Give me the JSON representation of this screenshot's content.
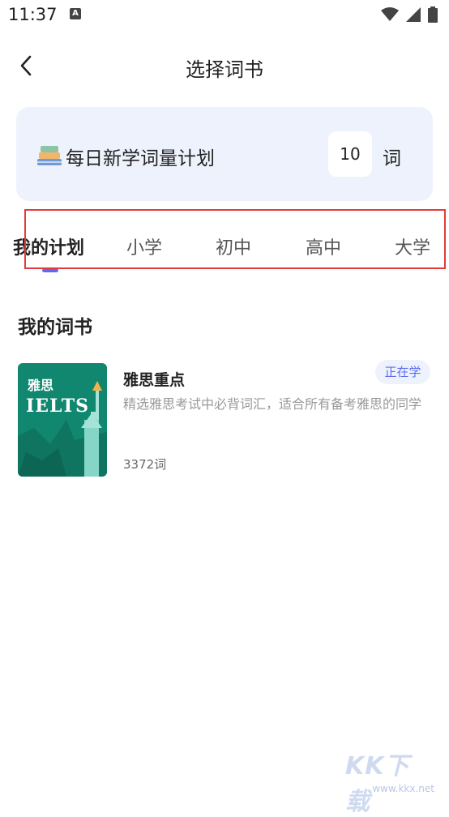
{
  "status_bar": {
    "time": "11:37",
    "notification_letter": "A"
  },
  "nav": {
    "title": "选择词书"
  },
  "plan": {
    "label": "每日新学词量计划",
    "value": "10",
    "unit": "词"
  },
  "tabs": [
    {
      "label": "我的计划",
      "active": true
    },
    {
      "label": "小学"
    },
    {
      "label": "初中"
    },
    {
      "label": "高中"
    },
    {
      "label": "大学"
    }
  ],
  "section": {
    "title": "我的词书"
  },
  "book": {
    "title": "雅思重点",
    "status": "正在学",
    "description": "精选雅思考试中必背词汇，适合所有备考雅思的同学",
    "count": "3372词",
    "cover_cn": "雅思",
    "cover_en": "IELTS"
  },
  "watermark": {
    "text": "KK下载",
    "url": "www.kkx.net"
  },
  "colors": {
    "accent": "#5a6cf0",
    "card_bg": "#eef2fd",
    "cover": "#12876f",
    "highlight_box": "#e23b3b"
  }
}
